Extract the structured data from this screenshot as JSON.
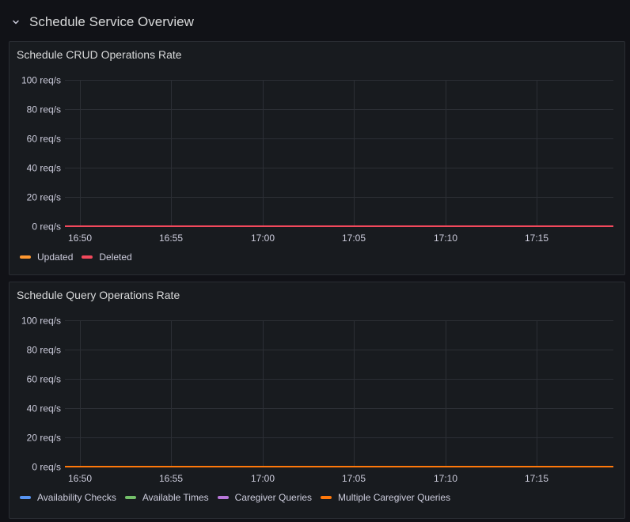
{
  "row": {
    "title": "Schedule Service Overview",
    "icon": "chevron-down-icon"
  },
  "colors": {
    "updated": "#FF9830",
    "deleted": "#F2495C",
    "availability_checks": "#5794F2",
    "available_times": "#73BF69",
    "caregiver_queries": "#B877D9",
    "multiple_caregiver_queries": "#FF780A"
  },
  "panels": [
    {
      "title": "Schedule CRUD Operations Rate",
      "legend": [
        {
          "label": "Updated",
          "color": "#FF9830"
        },
        {
          "label": "Deleted",
          "color": "#F2495C"
        }
      ]
    },
    {
      "title": "Schedule Query Operations Rate",
      "legend": [
        {
          "label": "Availability Checks",
          "color": "#5794F2"
        },
        {
          "label": "Available Times",
          "color": "#73BF69"
        },
        {
          "label": "Caregiver Queries",
          "color": "#B877D9"
        },
        {
          "label": "Multiple Caregiver Queries",
          "color": "#FF780A"
        }
      ]
    }
  ],
  "chart_data": [
    {
      "type": "line",
      "title": "Schedule CRUD Operations Rate",
      "x": [
        "16:50",
        "16:55",
        "17:00",
        "17:05",
        "17:10",
        "17:15"
      ],
      "y_ticks": [
        "0 req/s",
        "20 req/s",
        "40 req/s",
        "60 req/s",
        "80 req/s",
        "100 req/s"
      ],
      "ylim": [
        0,
        100
      ],
      "grid": true,
      "legend_position": "bottom-left",
      "series": [
        {
          "name": "Updated",
          "values": [
            0,
            0,
            0,
            0,
            0,
            0
          ]
        },
        {
          "name": "Deleted",
          "values": [
            0,
            0,
            0,
            0,
            0,
            0
          ]
        }
      ]
    },
    {
      "type": "line",
      "title": "Schedule Query Operations Rate",
      "x": [
        "16:50",
        "16:55",
        "17:00",
        "17:05",
        "17:10",
        "17:15"
      ],
      "y_ticks": [
        "0 req/s",
        "20 req/s",
        "40 req/s",
        "60 req/s",
        "80 req/s",
        "100 req/s"
      ],
      "ylim": [
        0,
        100
      ],
      "grid": true,
      "legend_position": "bottom-left",
      "series": [
        {
          "name": "Availability Checks",
          "values": [
            0,
            0,
            0,
            0,
            0,
            0
          ]
        },
        {
          "name": "Available Times",
          "values": [
            0,
            0,
            0,
            0,
            0,
            0
          ]
        },
        {
          "name": "Caregiver Queries",
          "values": [
            0,
            0,
            0,
            0,
            0,
            0
          ]
        },
        {
          "name": "Multiple Caregiver Queries",
          "values": [
            0,
            0,
            0,
            0,
            0,
            0
          ]
        }
      ]
    }
  ]
}
